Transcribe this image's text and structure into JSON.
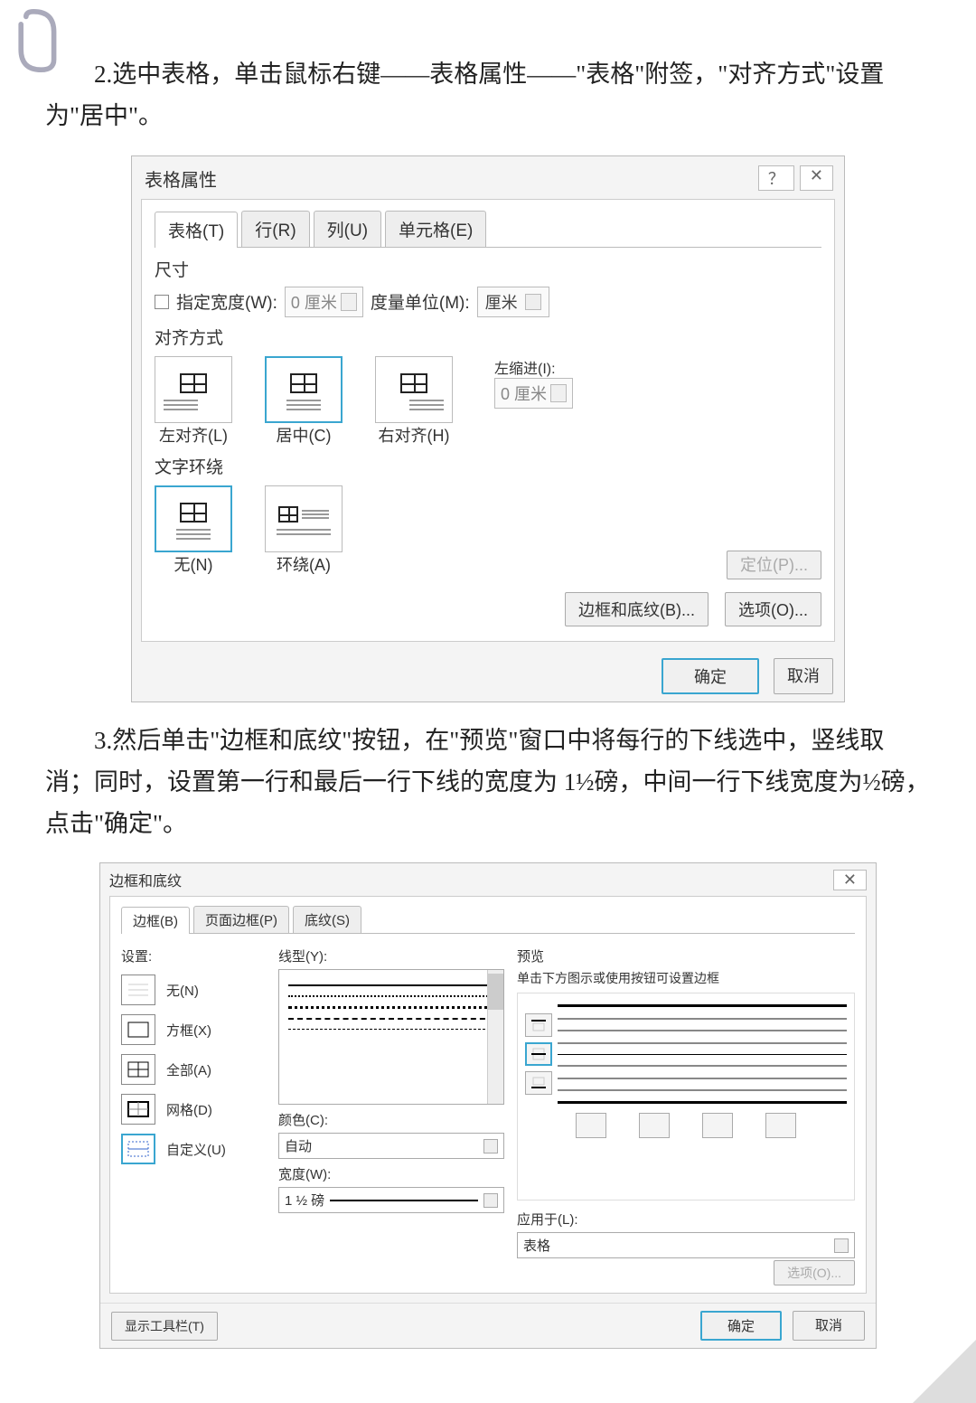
{
  "para2": "2.选中表格，单击鼠标右键——表格属性——\"表格\"附签，\"对齐方式\"设置为\"居中\"。",
  "para3": "3.然后单击\"边框和底纹\"按钮，在\"预览\"窗口中将每行的下线选中，竖线取消；同时，设置第一行和最后一行下线的宽度为 1½磅，中间一行下线宽度为½磅，点击\"确定\"。",
  "dlg1": {
    "title": "表格属性",
    "help": "？",
    "close": "✕",
    "tabs": {
      "table": "表格(T)",
      "row": "行(R)",
      "col": "列(U)",
      "cell": "单元格(E)"
    },
    "size_label": "尺寸",
    "spec_width": "指定宽度(W):",
    "width_val": "0 厘米",
    "unit_label": "度量单位(M):",
    "unit_val": "厘米",
    "align_label": "对齐方式",
    "align": {
      "left": "左对齐(L)",
      "center": "居中(C)",
      "right": "右对齐(H)"
    },
    "indent_label": "左缩进(I):",
    "indent_val": "0 厘米",
    "wrap_label": "文字环绕",
    "wrap": {
      "none": "无(N)",
      "around": "环绕(A)"
    },
    "position_btn": "定位(P)...",
    "border_btn": "边框和底纹(B)...",
    "options_btn": "选项(O)...",
    "ok": "确定",
    "cancel": "取消"
  },
  "dlg2": {
    "title": "边框和底纹",
    "close": "✕",
    "tabs": {
      "border": "边框(B)",
      "page": "页面边框(P)",
      "shading": "底纹(S)"
    },
    "setting_label": "设置:",
    "settings": {
      "none": "无(N)",
      "box": "方框(X)",
      "all": "全部(A)",
      "grid": "网格(D)",
      "custom": "自定义(U)"
    },
    "style_label": "线型(Y):",
    "color_label": "颜色(C):",
    "color_val": "自动",
    "width_label": "宽度(W):",
    "width_val": "1 ½ 磅",
    "preview_label": "预览",
    "preview_hint": "单击下方图示或使用按钮可设置边框",
    "apply_label": "应用于(L):",
    "apply_val": "表格",
    "opts_btn": "选项(O)...",
    "toolbar_btn": "显示工具栏(T)",
    "ok": "确定",
    "cancel": "取消"
  }
}
